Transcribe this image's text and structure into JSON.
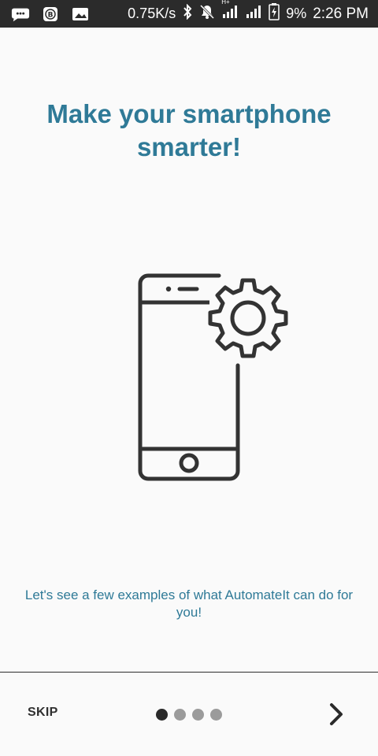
{
  "status_bar": {
    "net_speed": "0.75K/s",
    "battery_percent": "9%",
    "time": "2:26 PM",
    "network_type": "H+",
    "icons": [
      "message-icon",
      "bitcoin-icon",
      "image-icon",
      "bluetooth-icon",
      "notifications-off-icon",
      "signal-icon",
      "signal-icon",
      "battery-charging-icon"
    ]
  },
  "onboarding": {
    "title_line1": "Make your smartphone",
    "title_line2": "smarter!",
    "illustration_icon": "phone-settings-icon",
    "description": "Let's see a few examples of what AutomateIt can do for you!",
    "page_total": 4,
    "page_current": 1
  },
  "footer": {
    "skip_label": "SKIP",
    "next_icon": "chevron-right-icon"
  },
  "colors": {
    "accent": "#2f7a97",
    "status_bar_bg": "#2b2b2b",
    "dot_active": "#2a2a2a",
    "dot_inactive": "#9b9b9b"
  }
}
